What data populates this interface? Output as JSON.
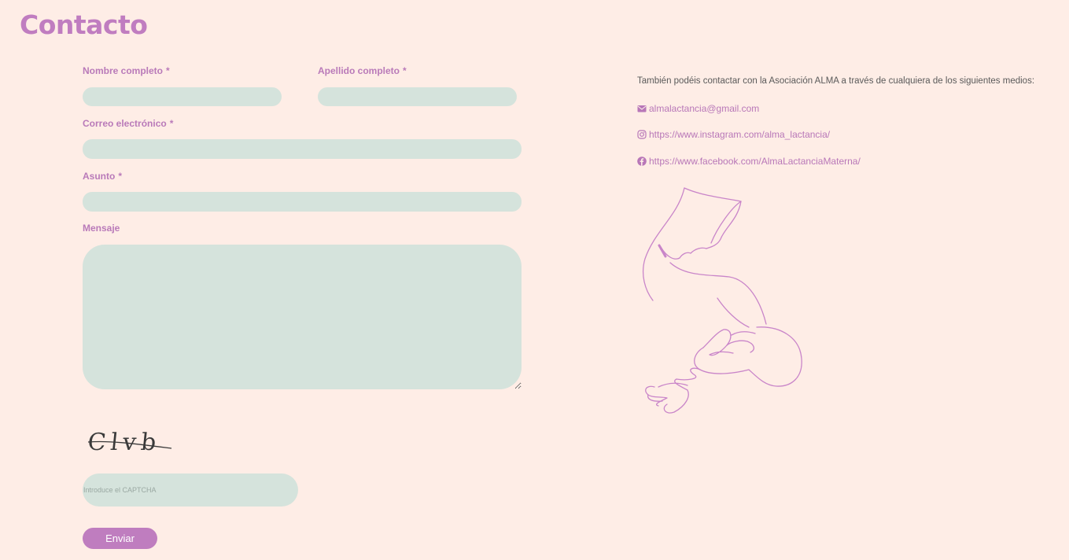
{
  "page": {
    "title": "Contacto"
  },
  "form": {
    "first_name": {
      "label": "Nombre completo",
      "required_mark": "*",
      "value": ""
    },
    "last_name": {
      "label": "Apellido completo",
      "required_mark": "*",
      "value": ""
    },
    "email": {
      "label": "Correo electrónico",
      "required_mark": "*",
      "value": ""
    },
    "subject": {
      "label": "Asunto",
      "required_mark": "*",
      "value": ""
    },
    "message": {
      "label": "Mensaje",
      "value": ""
    },
    "captcha": {
      "image_text": "Clvb",
      "placeholder": "Introduce el CAPTCHA",
      "value": ""
    },
    "submit_label": "Enviar"
  },
  "contact": {
    "intro": "También podéis contactar con la Asociación ALMA a través de cualquiera de los siguientes medios:",
    "email": {
      "icon": "envelope-icon",
      "text": "almalactancia@gmail.com"
    },
    "instagram": {
      "icon": "instagram-icon",
      "text": "https://www.instagram.com/alma_lactancia/"
    },
    "facebook": {
      "icon": "facebook-icon",
      "text": "https://www.facebook.com/AlmaLactanciaMaterna/"
    }
  },
  "colors": {
    "background": "#feede6",
    "accent": "#bf7dbf",
    "field": "#d5e3dc"
  }
}
